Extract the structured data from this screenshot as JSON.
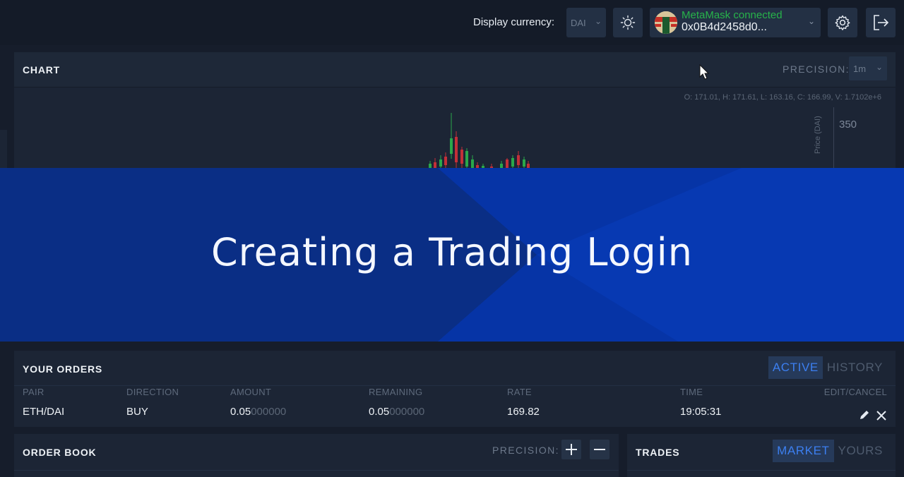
{
  "header": {
    "display_currency_label": "Display currency:",
    "display_currency_value": "DAI",
    "theme_icon": "sun-icon",
    "wallet": {
      "status": "MetaMask connected",
      "address": "0x0B4d2458d0...",
      "status_color": "#27b34a"
    },
    "settings_icon": "gear-icon",
    "logout_icon": "logout-icon"
  },
  "chart_panel": {
    "title": "CHART",
    "precision_label": "PRECISION:",
    "precision_value": "1m",
    "ohlc_readout": "O: 171.01, H: 171.61, L: 163.16, C: 166.99, V: 1.7102e+6",
    "y_axis_title": "Price (DAI)",
    "y_tick": "350",
    "up_color": "#2aa84a",
    "down_color": "#c33038"
  },
  "banner": {
    "title": "Creating a Trading Login",
    "colors": {
      "left": "#0b2f86",
      "right": "#0739b2"
    }
  },
  "orders_panel": {
    "title": "YOUR ORDERS",
    "tabs": [
      "ACTIVE",
      "HISTORY"
    ],
    "active_tab": "ACTIVE",
    "columns": [
      "PAIR",
      "DIRECTION",
      "AMOUNT",
      "REMAINING",
      "RATE",
      "TIME",
      "EDIT/CANCEL"
    ],
    "rows": [
      {
        "pair": "ETH/DAI",
        "direction": "BUY",
        "amount_main": "0.05",
        "amount_trail": "000000",
        "remaining_main": "0.05",
        "remaining_trail": "000000",
        "rate": "169.82",
        "time": "19:05:31",
        "edit_icon": "pencil-icon",
        "cancel_icon": "close-icon"
      }
    ]
  },
  "order_book": {
    "title": "ORDER BOOK",
    "precision_label": "PRECISION:",
    "plus_icon": "plus-icon",
    "minus_icon": "minus-icon"
  },
  "trades": {
    "title": "TRADES",
    "tabs": [
      "MARKET",
      "YOURS"
    ],
    "active_tab": "MARKET"
  }
}
